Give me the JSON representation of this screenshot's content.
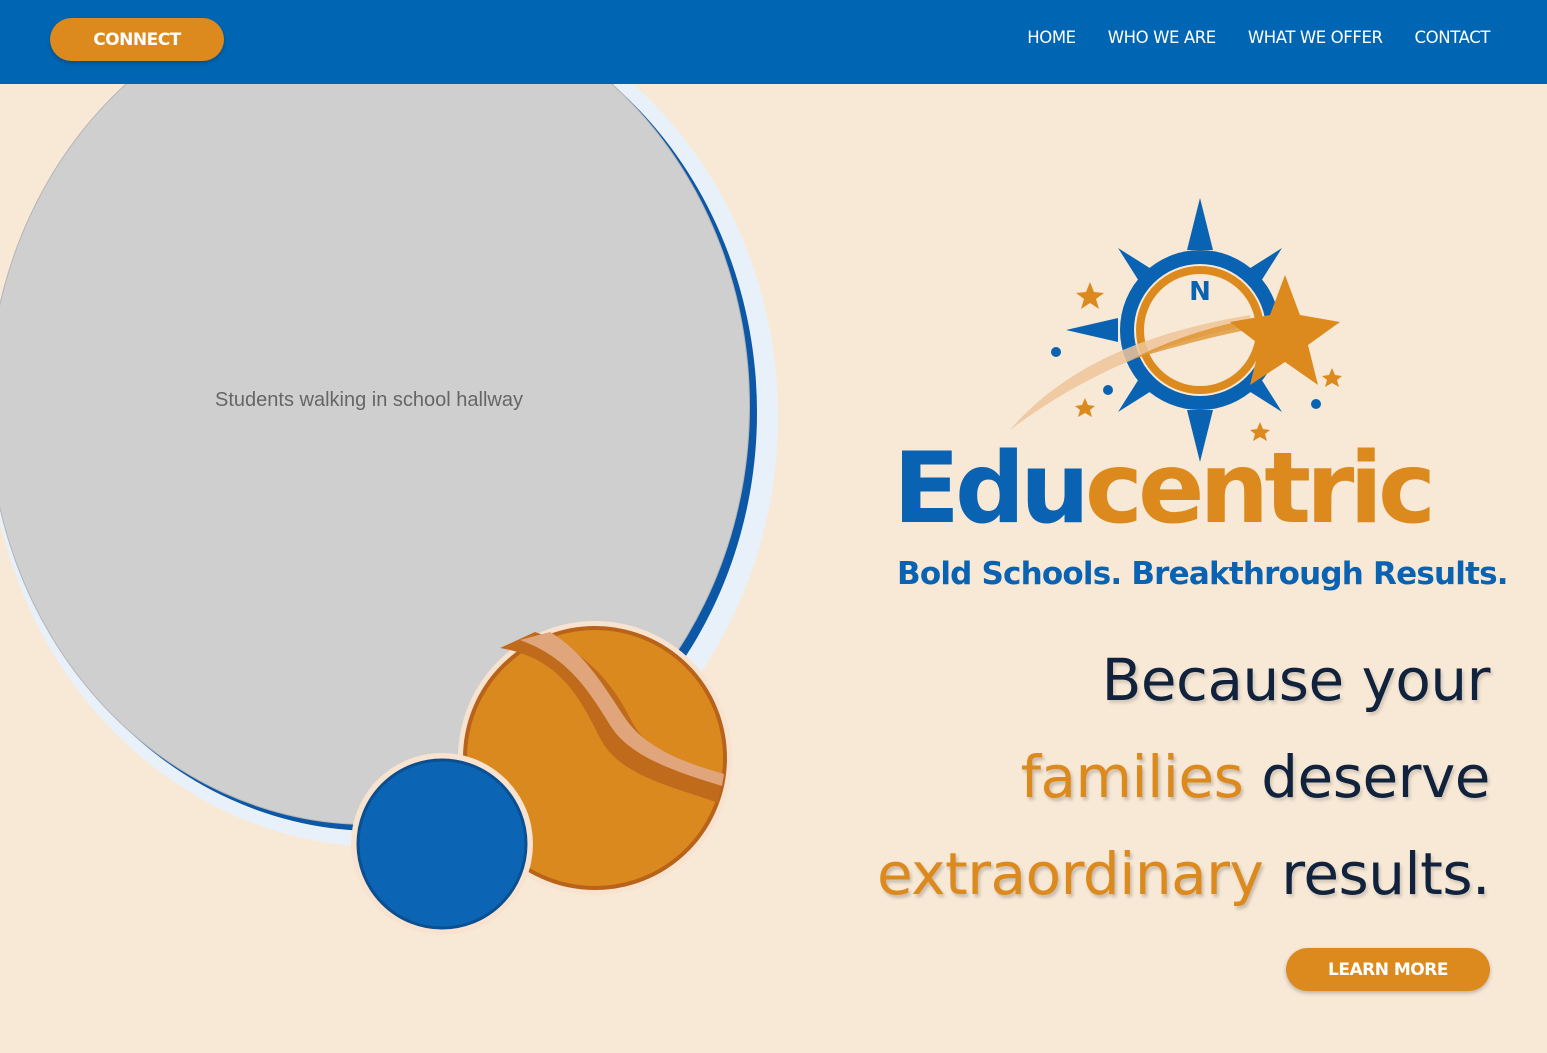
{
  "header": {
    "connect_label": "CONNECT",
    "nav": [
      {
        "label": "HOME"
      },
      {
        "label": "WHO WE ARE"
      },
      {
        "label": "WHAT WE OFFER"
      },
      {
        "label": "CONTACT"
      }
    ]
  },
  "logo": {
    "compass_letter": "N",
    "brand_part1": "Edu",
    "brand_part2": "centric",
    "tagline": "Bold Schools. Breakthrough Results."
  },
  "hero": {
    "line1": "Because your",
    "line2_highlight": "families",
    "line2_rest": "deserve",
    "line3_highlight": "extraordinary",
    "line3_rest": "results.",
    "cta_label": "LEARN MORE",
    "image_label": "Students walking in school hallway"
  },
  "colors": {
    "header_blue": "#0066b3",
    "accent_orange": "#dc8a1d",
    "page_bg": "#f8e9d7",
    "text_dark": "#10223c"
  },
  "icons": [
    "compass-icon",
    "shooting-star-icon"
  ]
}
